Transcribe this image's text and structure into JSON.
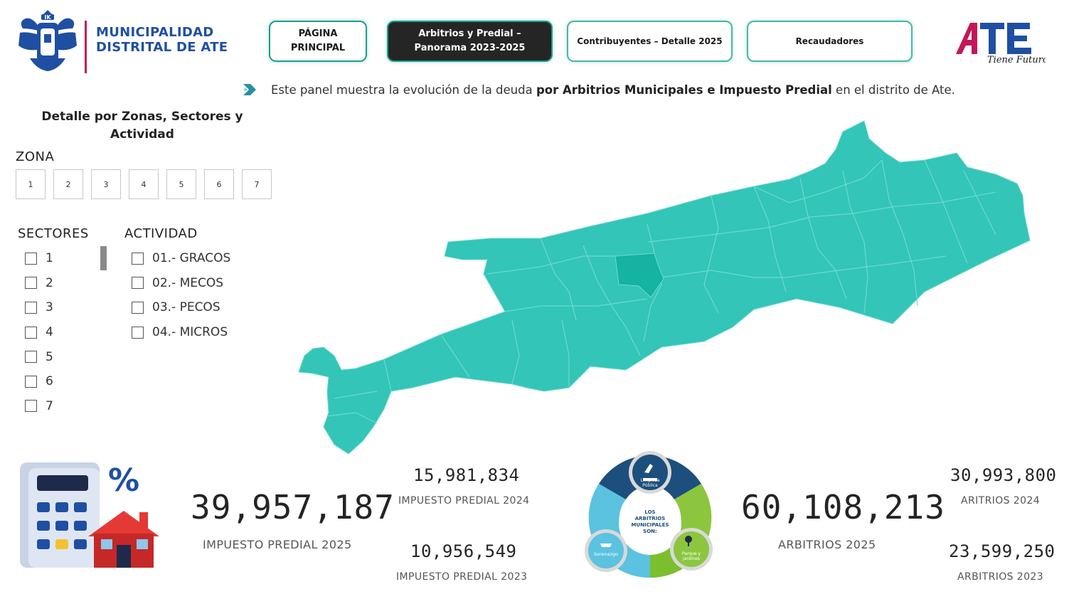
{
  "header": {
    "org_line1": "MUNICIPALIDAD",
    "org_line2": "DISTRITAL DE ATE",
    "crest_icon": "municipal-crest-icon",
    "brand_logo_text": "ATE",
    "brand_tagline": "Tiene Futuro",
    "nav": [
      {
        "line1": "PÁGINA",
        "line2": "PRINCIPAL",
        "active": false
      },
      {
        "line1": "Arbitrios y Predial –",
        "line2": "Panorama 2023-2025",
        "active": true
      },
      {
        "line1": "Contribuyentes – Detalle 2025",
        "line2": "",
        "active": false
      },
      {
        "line1": "Recaudadores",
        "line2": "",
        "active": false
      }
    ]
  },
  "description": {
    "prefix": "Este panel muestra la evolución de la deuda ",
    "bold": "por Arbitrios Municipales e Impuesto Predial",
    "suffix": " en el distrito de Ate."
  },
  "filters": {
    "title_line1": "Detalle por Zonas, Sectores y",
    "title_line2": "Actividad",
    "zona_label": "ZONA",
    "zonas": [
      "1",
      "2",
      "3",
      "4",
      "5",
      "6",
      "7"
    ],
    "sectores_label": "SECTORES",
    "sectores": [
      "1",
      "2",
      "3",
      "4",
      "5",
      "6",
      "7"
    ],
    "actividad_label": "ACTIVIDAD",
    "actividades": [
      "01.- GRACOS",
      "02.- MECOS",
      "03.- PECOS",
      "04.- MICROS"
    ]
  },
  "map": {
    "fill_color": "#33c5b8",
    "selected_color": "#14b3a2",
    "border_color": "#6ed9cf"
  },
  "kpis": {
    "predial_2025_value": "39,957,187",
    "predial_2025_label": "IMPUESTO PREDIAL 2025",
    "predial_2024_value": "15,981,834",
    "predial_2024_label": "IMPUESTO PREDIAL 2024",
    "predial_2023_value": "10,956,549",
    "predial_2023_label": "IMPUESTO PREDIAL 2023",
    "arbitrios_2025_value": "60,108,213",
    "arbitrios_2025_label": "ARBITRIOS 2025",
    "arbitrios_2024_value": "30,993,800",
    "arbitrios_2024_label": "ARITRIOS 2024",
    "arbitrios_2023_value": "23,599,250",
    "arbitrios_2023_label": "ARBITRIOS 2023"
  },
  "wheel": {
    "center_line1": "LOS",
    "center_line2": "ARBITRIOS",
    "center_line3": "MUNICIPALES",
    "center_line4": "SON:",
    "item1_line1": "Limpieza",
    "item1_line2": "Pública",
    "item2": "Serenazgo",
    "item3_line1": "Parque y",
    "item3_line2": "jardines",
    "colors": {
      "navy": "#1d4f7c",
      "green": "#8cc63f",
      "cyan": "#5bc2e0"
    }
  }
}
